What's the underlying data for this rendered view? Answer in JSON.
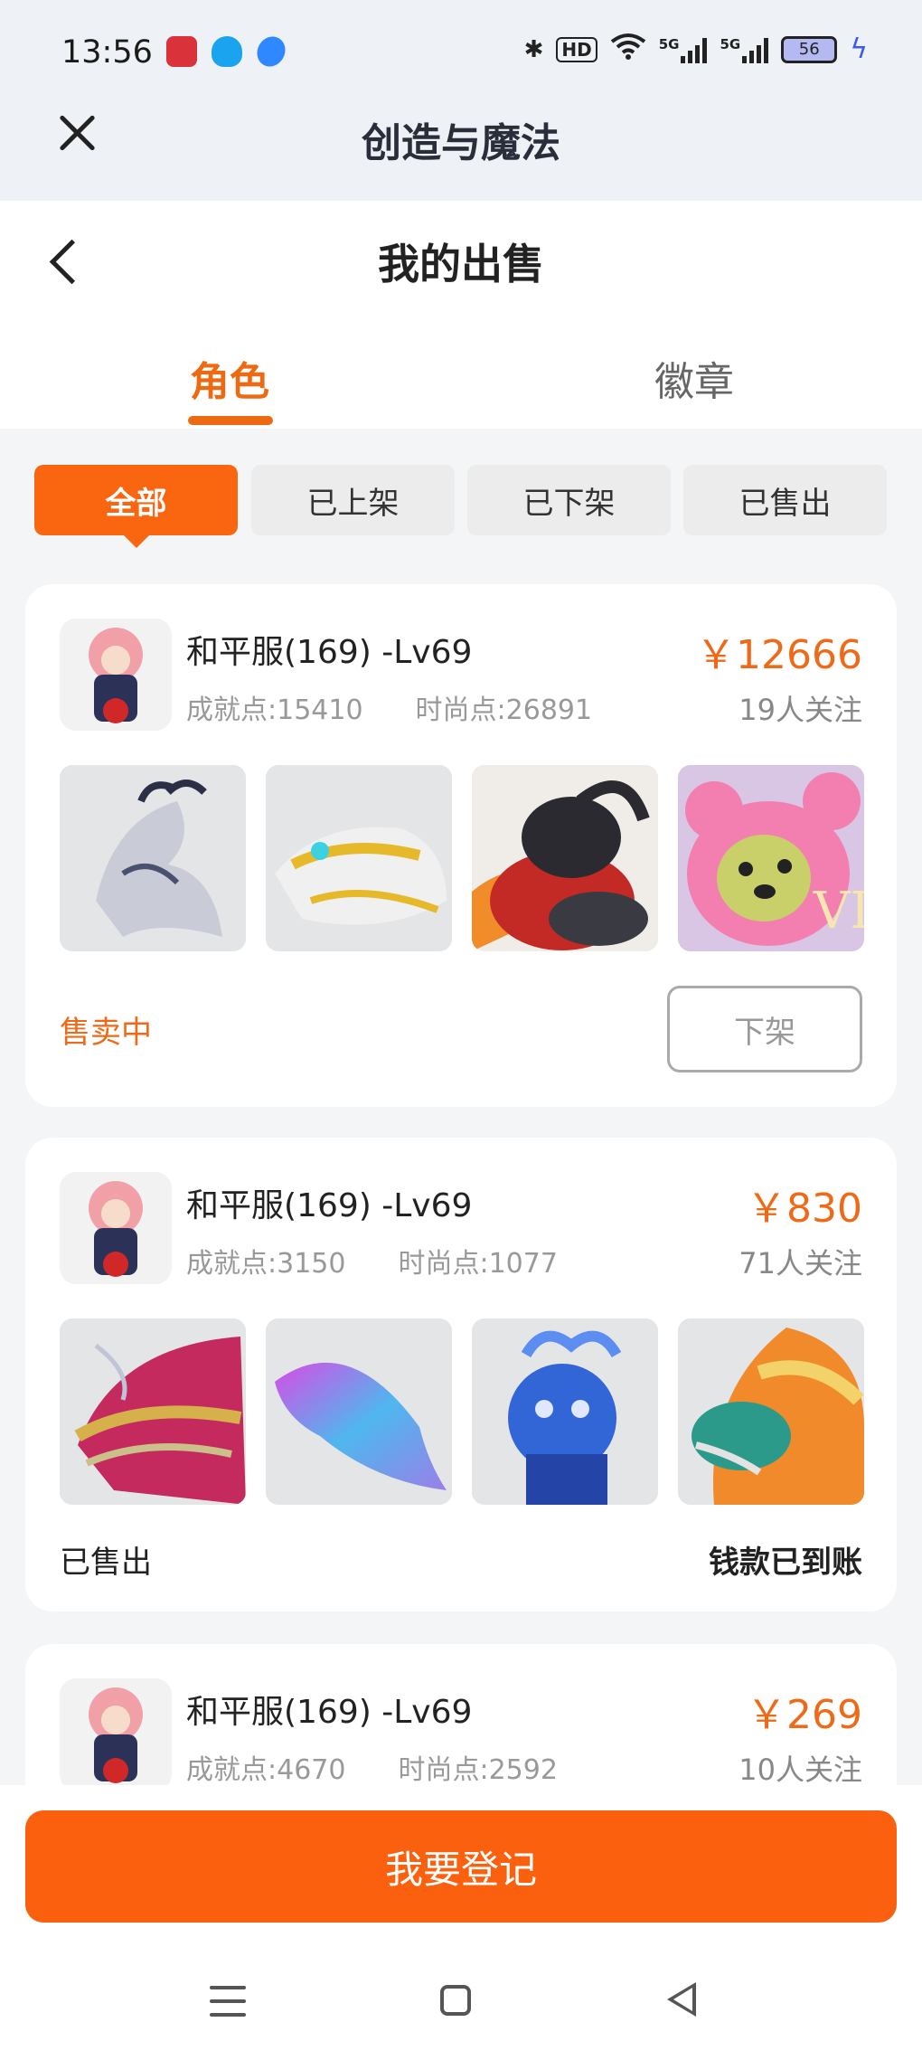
{
  "status_bar": {
    "time": "13:56",
    "hd": "HD",
    "net1": "5G",
    "net2": "5G",
    "battery": "56"
  },
  "mini_program": {
    "title": "创造与魔法"
  },
  "page": {
    "title": "我的出售"
  },
  "tabs": [
    {
      "label": "角色",
      "active": true
    },
    {
      "label": "徽章",
      "active": false
    }
  ],
  "filters": [
    {
      "label": "全部",
      "active": true
    },
    {
      "label": "已上架",
      "active": false
    },
    {
      "label": "已下架",
      "active": false
    },
    {
      "label": "已售出",
      "active": false
    }
  ],
  "listings": [
    {
      "name": "和平服(169) -Lv69",
      "achievement": "成就点:15410",
      "fashion": "时尚点:26891",
      "price": "￥12666",
      "followers": "19人关注",
      "status": "售卖中",
      "action": "下架",
      "thumbs": [
        "silver-dragon",
        "golden-dragon",
        "dark-beasts",
        "pink-bear"
      ]
    },
    {
      "name": "和平服(169) -Lv69",
      "achievement": "成就点:3150",
      "fashion": "时尚点:1077",
      "price": "￥830",
      "followers": "71人关注",
      "status": "已售出",
      "note": "钱款已到账",
      "thumbs": [
        "red-gold-dragon",
        "rainbow-fin",
        "blue-dragon",
        "flame-dragon"
      ]
    },
    {
      "name": "和平服(169) -Lv69",
      "achievement": "成就点:4670",
      "fashion": "时尚点:2592",
      "price": "￥269",
      "followers": "10人关注"
    }
  ],
  "register_button": "我要登记",
  "colors": {
    "accent": "#fa6510",
    "price": "#ee6a18"
  }
}
